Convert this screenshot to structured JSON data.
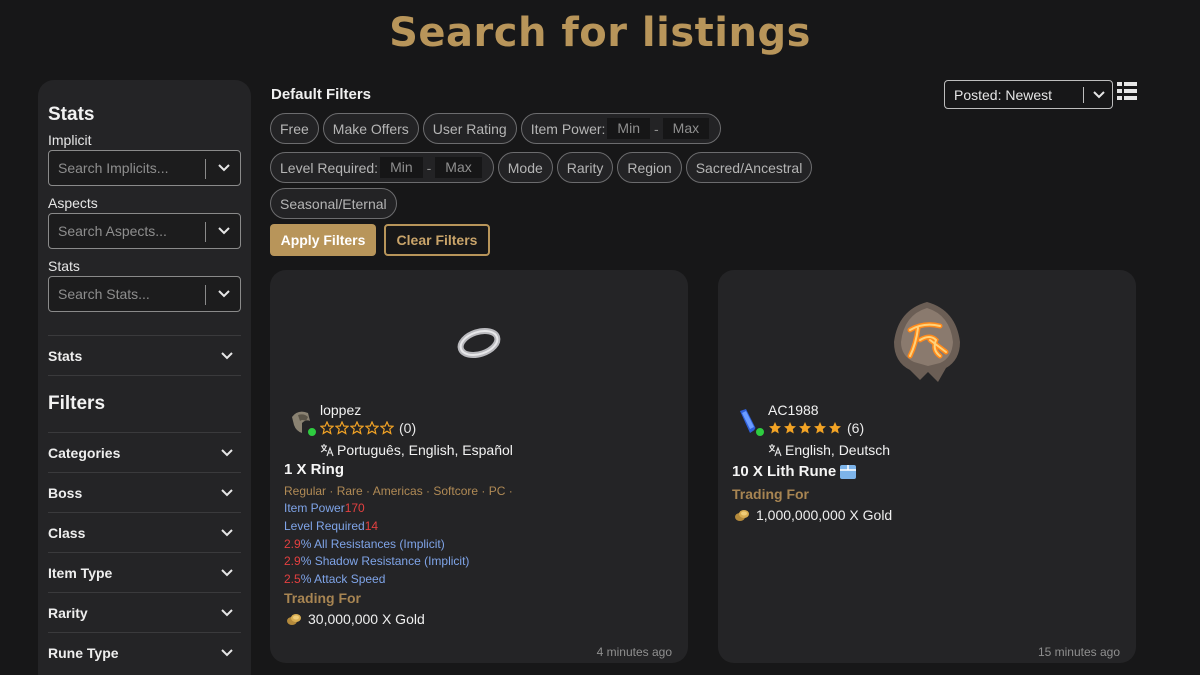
{
  "page_title": "Search for listings",
  "sidebar": {
    "stats_heading": "Stats",
    "implicit_label": "Implicit",
    "implicit_placeholder": "Search Implicits...",
    "aspects_label": "Aspects",
    "aspects_placeholder": "Search Aspects...",
    "stats_label": "Stats",
    "stats_placeholder": "Search Stats...",
    "stats_row": "Stats",
    "filters_heading": "Filters",
    "filter_rows": [
      "Categories",
      "Boss",
      "Class",
      "Item Type",
      "Rarity",
      "Rune Type"
    ]
  },
  "filters": {
    "heading": "Default Filters",
    "chips_row1": [
      "Free",
      "Make Offers",
      "User Rating"
    ],
    "item_power_label": "Item Power:",
    "level_required_label": "Level Required:",
    "min_placeholder": "Min",
    "max_placeholder": "Max",
    "dash": "-",
    "chips_row2": [
      "Mode",
      "Rarity",
      "Region",
      "Sacred/Ancestral"
    ],
    "chips_row3": [
      "Seasonal/Eternal"
    ],
    "apply_label": "Apply Filters",
    "clear_label": "Clear Filters"
  },
  "sort": {
    "selected": "Posted: Newest"
  },
  "listings": [
    {
      "seller": "loppez",
      "rating_count": "(0)",
      "stars_filled": 0,
      "languages": "Português, English, Español",
      "title": "1 X Ring",
      "tags": "Regular · Rare · Americas · Softcore · PC ·",
      "item_power_label": "Item Power",
      "item_power": "170",
      "level_required_label": "Level Required",
      "level_required": "14",
      "affixes": [
        {
          "value": "2.9",
          "text": "% All Resistances (Implicit)"
        },
        {
          "value": "2.9",
          "text": "% Shadow Resistance (Implicit)"
        },
        {
          "value": "2.5",
          "text": "% Attack Speed"
        }
      ],
      "trading_for": "Trading For",
      "price": "30,000,000 X Gold",
      "time": "4 minutes ago"
    },
    {
      "seller": "AC1988",
      "rating_count": "(6)",
      "stars_filled": 5,
      "languages": "English, Deutsch",
      "title": "10 X Lith Rune",
      "trading_for": "Trading For",
      "price": "1,000,000,000 X Gold",
      "time": "15 minutes ago"
    }
  ],
  "colors": {
    "accent": "#b8955a",
    "background": "#171718",
    "card": "#242426",
    "online": "#2ecc40",
    "stat_number": "#e34040",
    "stat_text": "#7fa4e8"
  }
}
